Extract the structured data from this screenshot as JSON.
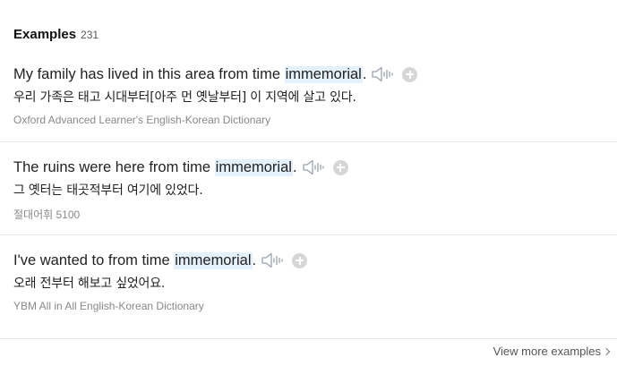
{
  "header": {
    "title": "Examples",
    "count": "231"
  },
  "examples": [
    {
      "before": "My family has lived in this area from time ",
      "highlight": "immemorial",
      "after": ".",
      "translation": "우리 가족은 태고 시대부터[아주 먼 옛날부터] 이 지역에 살고 있다.",
      "source": "Oxford Advanced Learner's English-Korean Dictionary"
    },
    {
      "before": "The ruins were here from time ",
      "highlight": "immemorial",
      "after": ".",
      "translation": "그 옛터는 태곳적부터 여기에 있었다.",
      "source": "절대어휘 5100"
    },
    {
      "before": "I've wanted to from time ",
      "highlight": "immemorial",
      "after": ".",
      "translation": "오래 전부터 해보고 싶었어요.",
      "source": "YBM All in All English-Korean Dictionary"
    }
  ],
  "icons": {
    "speaker": "speaker-icon",
    "add": "plus-circle-icon",
    "more": "chevron-right-icon"
  },
  "colors": {
    "highlight": "#e4f0fb",
    "speaker": "#9aa3ad",
    "add_button": "#d6d6d6"
  },
  "footer": {
    "view_more": "View more examples"
  }
}
